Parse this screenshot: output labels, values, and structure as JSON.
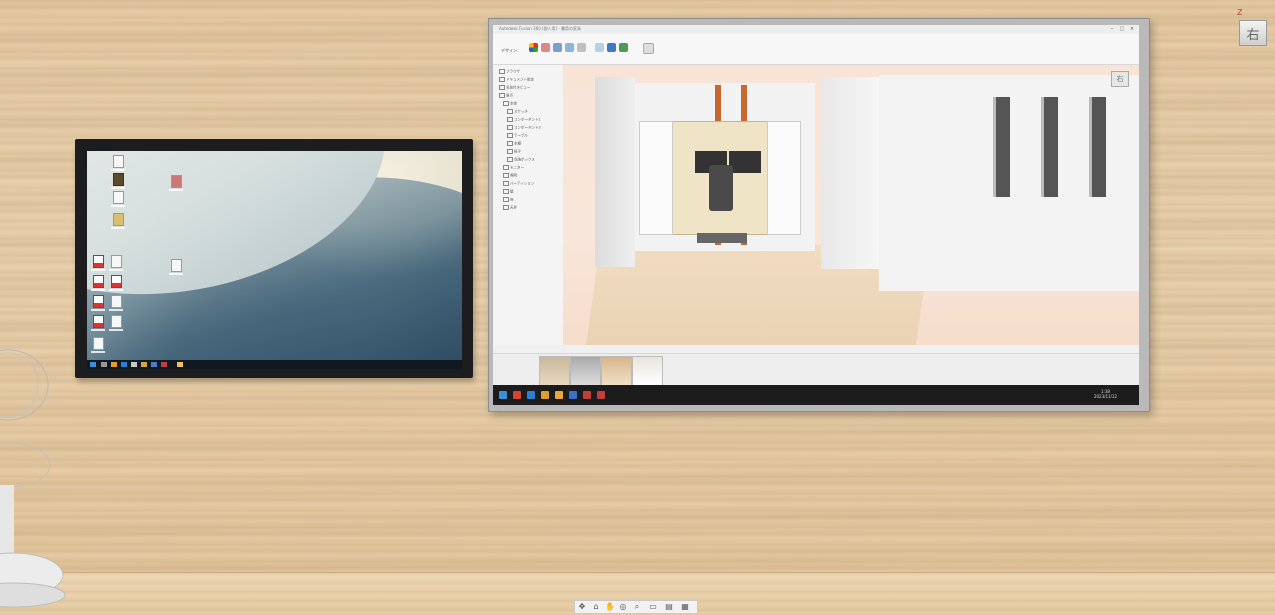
{
  "nav_cube": {
    "face_label": "右",
    "axis_label": "Z"
  },
  "right_app": {
    "title": "Autodesk Fusion 360 (個人用) - 書斎の家具",
    "workspace": "デザイン",
    "tree_items": [
      "ブラウザ",
      "ドキュメント設定",
      "名前付きビュー",
      "原点",
      "本体",
      "スケッチ",
      "コンポーネント1",
      "コンポーネント2",
      "テーブル",
      "本棚",
      "椅子",
      "収納ボックス",
      "モニター",
      "照明",
      "パーティション",
      "壁",
      "床",
      "天井"
    ],
    "viewcube_label": "右",
    "clock_time": "1:38",
    "clock_date": "2023/11/12"
  },
  "colors": {
    "wood": "#e4c9a3",
    "viewport_bg": "#f8e4d7",
    "taskbar": "#1c1c1c",
    "accent_orange": "#c7692f"
  },
  "bottom_toolbar_icons": [
    "orbit-icon",
    "pan-icon",
    "hand-icon",
    "look-icon",
    "zoom-icon",
    "display-icon",
    "visual-style-icon",
    "grid-icon"
  ]
}
